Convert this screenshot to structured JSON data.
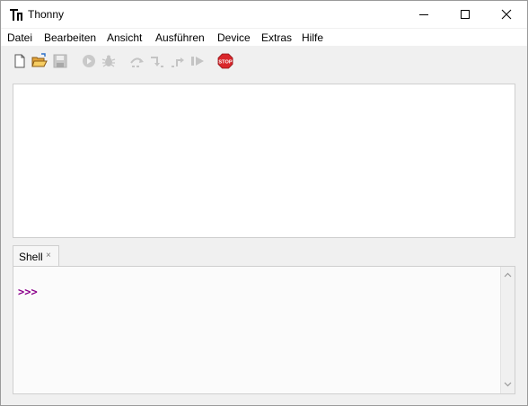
{
  "window": {
    "title": "Thonny",
    "controls": {
      "minimize": "minimize-icon",
      "maximize": "maximize-icon",
      "close": "close-icon"
    }
  },
  "menu": {
    "items": [
      "Datei",
      "Bearbeiten",
      "Ansicht",
      "Ausführen",
      "Device",
      "Extras",
      "Hilfe"
    ]
  },
  "toolbar": {
    "buttons": [
      {
        "icon": "new-file-icon",
        "enabled": true
      },
      {
        "icon": "open-folder-icon",
        "enabled": true
      },
      {
        "icon": "save-icon",
        "enabled": false
      },
      {
        "icon": "run-icon",
        "enabled": false
      },
      {
        "icon": "debug-icon",
        "enabled": false
      },
      {
        "icon": "step-over-icon",
        "enabled": false
      },
      {
        "icon": "step-into-icon",
        "enabled": false
      },
      {
        "icon": "step-out-icon",
        "enabled": false
      },
      {
        "icon": "resume-icon",
        "enabled": false
      },
      {
        "icon": "stop-icon",
        "enabled": true
      }
    ],
    "stop_label": "STOP"
  },
  "shell": {
    "tab_label": "Shell",
    "tab_close": "×",
    "prompt": ">>>"
  },
  "colors": {
    "prompt": "#8b008b",
    "stop": "#d9262b"
  }
}
